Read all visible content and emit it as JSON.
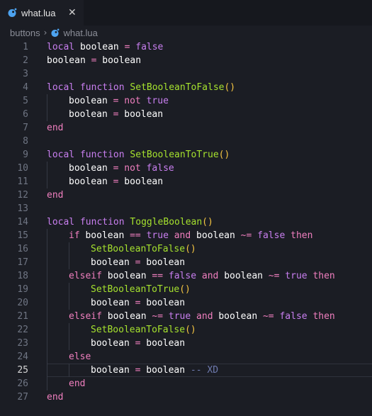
{
  "tab": {
    "filename": "what.lua",
    "close": "✕"
  },
  "breadcrumb": {
    "folder": "buttons",
    "separator": "›",
    "file": "what.lua"
  },
  "editor": {
    "active_line": 25,
    "lines": [
      {
        "n": "1",
        "indent": 0,
        "tokens": [
          [
            "local",
            "kw"
          ],
          [
            " ",
            ""
          ],
          [
            "boolean",
            "id"
          ],
          [
            " ",
            ""
          ],
          [
            "=",
            "op"
          ],
          [
            " ",
            ""
          ],
          [
            "false",
            "kw"
          ]
        ]
      },
      {
        "n": "2",
        "indent": 0,
        "tokens": [
          [
            "boolean",
            "id"
          ],
          [
            " ",
            ""
          ],
          [
            "=",
            "op"
          ],
          [
            " ",
            ""
          ],
          [
            "boolean",
            "id"
          ]
        ]
      },
      {
        "n": "3",
        "indent": 0,
        "tokens": []
      },
      {
        "n": "4",
        "indent": 0,
        "tokens": [
          [
            "local",
            "kw"
          ],
          [
            " ",
            ""
          ],
          [
            "function",
            "kw"
          ],
          [
            " ",
            ""
          ],
          [
            "SetBooleanToFalse",
            "fn"
          ],
          [
            "()",
            "pn"
          ]
        ]
      },
      {
        "n": "5",
        "indent": 1,
        "tokens": [
          [
            "boolean",
            "id"
          ],
          [
            " ",
            ""
          ],
          [
            "=",
            "op"
          ],
          [
            " ",
            ""
          ],
          [
            "not",
            "op"
          ],
          [
            " ",
            ""
          ],
          [
            "true",
            "kw"
          ]
        ]
      },
      {
        "n": "6",
        "indent": 1,
        "tokens": [
          [
            "boolean",
            "id"
          ],
          [
            " ",
            ""
          ],
          [
            "=",
            "op"
          ],
          [
            " ",
            ""
          ],
          [
            "boolean",
            "id"
          ]
        ]
      },
      {
        "n": "7",
        "indent": 0,
        "tokens": [
          [
            "end",
            "op"
          ]
        ]
      },
      {
        "n": "8",
        "indent": 0,
        "tokens": []
      },
      {
        "n": "9",
        "indent": 0,
        "tokens": [
          [
            "local",
            "kw"
          ],
          [
            " ",
            ""
          ],
          [
            "function",
            "kw"
          ],
          [
            " ",
            ""
          ],
          [
            "SetBooleanToTrue",
            "fn"
          ],
          [
            "()",
            "pn"
          ]
        ]
      },
      {
        "n": "10",
        "indent": 1,
        "tokens": [
          [
            "boolean",
            "id"
          ],
          [
            " ",
            ""
          ],
          [
            "=",
            "op"
          ],
          [
            " ",
            ""
          ],
          [
            "not",
            "op"
          ],
          [
            " ",
            ""
          ],
          [
            "false",
            "kw"
          ]
        ]
      },
      {
        "n": "11",
        "indent": 1,
        "tokens": [
          [
            "boolean",
            "id"
          ],
          [
            " ",
            ""
          ],
          [
            "=",
            "op"
          ],
          [
            " ",
            ""
          ],
          [
            "boolean",
            "id"
          ]
        ]
      },
      {
        "n": "12",
        "indent": 0,
        "tokens": [
          [
            "end",
            "op"
          ]
        ]
      },
      {
        "n": "13",
        "indent": 0,
        "tokens": []
      },
      {
        "n": "14",
        "indent": 0,
        "tokens": [
          [
            "local",
            "kw"
          ],
          [
            " ",
            ""
          ],
          [
            "function",
            "kw"
          ],
          [
            " ",
            ""
          ],
          [
            "ToggleBoolean",
            "fn"
          ],
          [
            "()",
            "pn"
          ]
        ]
      },
      {
        "n": "15",
        "indent": 1,
        "tokens": [
          [
            "if",
            "op"
          ],
          [
            " ",
            ""
          ],
          [
            "boolean",
            "id"
          ],
          [
            " ",
            ""
          ],
          [
            "==",
            "op"
          ],
          [
            " ",
            ""
          ],
          [
            "true",
            "kw"
          ],
          [
            " ",
            ""
          ],
          [
            "and",
            "op"
          ],
          [
            " ",
            ""
          ],
          [
            "boolean",
            "id"
          ],
          [
            " ",
            ""
          ],
          [
            "~=",
            "op"
          ],
          [
            " ",
            ""
          ],
          [
            "false",
            "kw"
          ],
          [
            " ",
            ""
          ],
          [
            "then",
            "op"
          ]
        ]
      },
      {
        "n": "16",
        "indent": 2,
        "tokens": [
          [
            "SetBooleanToFalse",
            "fn"
          ],
          [
            "()",
            "pn"
          ]
        ]
      },
      {
        "n": "17",
        "indent": 2,
        "tokens": [
          [
            "boolean",
            "id"
          ],
          [
            " ",
            ""
          ],
          [
            "=",
            "op"
          ],
          [
            " ",
            ""
          ],
          [
            "boolean",
            "id"
          ]
        ]
      },
      {
        "n": "18",
        "indent": 1,
        "tokens": [
          [
            "elseif",
            "op"
          ],
          [
            " ",
            ""
          ],
          [
            "boolean",
            "id"
          ],
          [
            " ",
            ""
          ],
          [
            "==",
            "op"
          ],
          [
            " ",
            ""
          ],
          [
            "false",
            "kw"
          ],
          [
            " ",
            ""
          ],
          [
            "and",
            "op"
          ],
          [
            " ",
            ""
          ],
          [
            "boolean",
            "id"
          ],
          [
            " ",
            ""
          ],
          [
            "~=",
            "op"
          ],
          [
            " ",
            ""
          ],
          [
            "true",
            "kw"
          ],
          [
            " ",
            ""
          ],
          [
            "then",
            "op"
          ]
        ]
      },
      {
        "n": "19",
        "indent": 2,
        "tokens": [
          [
            "SetBooleanToTrue",
            "fn"
          ],
          [
            "()",
            "pn"
          ]
        ]
      },
      {
        "n": "20",
        "indent": 2,
        "tokens": [
          [
            "boolean",
            "id"
          ],
          [
            " ",
            ""
          ],
          [
            "=",
            "op"
          ],
          [
            " ",
            ""
          ],
          [
            "boolean",
            "id"
          ]
        ]
      },
      {
        "n": "21",
        "indent": 1,
        "tokens": [
          [
            "elseif",
            "op"
          ],
          [
            " ",
            ""
          ],
          [
            "boolean",
            "id"
          ],
          [
            " ",
            ""
          ],
          [
            "~=",
            "op"
          ],
          [
            " ",
            ""
          ],
          [
            "true",
            "kw"
          ],
          [
            " ",
            ""
          ],
          [
            "and",
            "op"
          ],
          [
            " ",
            ""
          ],
          [
            "boolean",
            "id"
          ],
          [
            " ",
            ""
          ],
          [
            "~=",
            "op"
          ],
          [
            " ",
            ""
          ],
          [
            "false",
            "kw"
          ],
          [
            " ",
            ""
          ],
          [
            "then",
            "op"
          ]
        ]
      },
      {
        "n": "22",
        "indent": 2,
        "tokens": [
          [
            "SetBooleanToFalse",
            "fn"
          ],
          [
            "()",
            "pn"
          ]
        ]
      },
      {
        "n": "23",
        "indent": 2,
        "tokens": [
          [
            "boolean",
            "id"
          ],
          [
            " ",
            ""
          ],
          [
            "=",
            "op"
          ],
          [
            " ",
            ""
          ],
          [
            "boolean",
            "id"
          ]
        ]
      },
      {
        "n": "24",
        "indent": 1,
        "tokens": [
          [
            "else",
            "op"
          ]
        ]
      },
      {
        "n": "25",
        "indent": 2,
        "tokens": [
          [
            "boolean",
            "id"
          ],
          [
            " ",
            ""
          ],
          [
            "=",
            "op"
          ],
          [
            " ",
            ""
          ],
          [
            "boolean",
            "id"
          ],
          [
            " ",
            ""
          ],
          [
            "-- XD",
            "cm"
          ]
        ]
      },
      {
        "n": "26",
        "indent": 1,
        "tokens": [
          [
            "end",
            "op"
          ]
        ]
      },
      {
        "n": "27",
        "indent": 0,
        "tokens": [
          [
            "end",
            "op"
          ]
        ]
      }
    ]
  },
  "colors": {
    "background": "#1b1d24",
    "keyword": "#c97ff0",
    "function": "#a6e22e",
    "operator": "#f07fbf",
    "identifier": "#ffffff",
    "punctuation": "#f5c542",
    "comment": "#6f7bb0",
    "lua_icon": "#4da3f0"
  }
}
